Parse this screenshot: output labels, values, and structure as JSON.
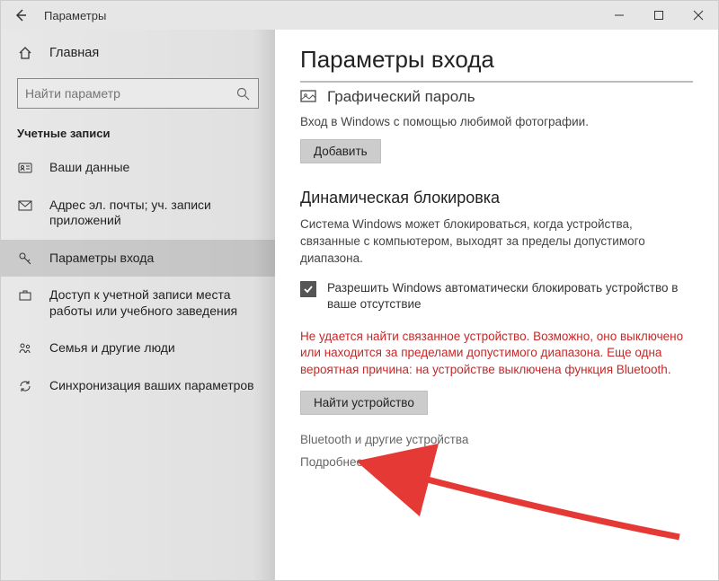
{
  "titlebar": {
    "title": "Параметры"
  },
  "sidebar": {
    "home_label": "Главная",
    "search_placeholder": "Найти параметр",
    "section_title": "Учетные записи",
    "items": [
      {
        "label": "Ваши данные"
      },
      {
        "label": "Адрес эл. почты; уч. записи приложений"
      },
      {
        "label": "Параметры входа"
      },
      {
        "label": "Доступ к учетной записи места работы или учебного заведения"
      },
      {
        "label": "Семья и другие люди"
      },
      {
        "label": "Синхронизация ваших параметров"
      }
    ]
  },
  "content": {
    "page_title": "Параметры входа",
    "picture_password_heading": "Графический пароль",
    "picture_password_desc": "Вход в Windows с помощью любимой фотографии.",
    "add_button": "Добавить",
    "dynlock_heading": "Динамическая блокировка",
    "dynlock_desc": "Система Windows может блокироваться, когда устройства, связанные с компьютером, выходят за пределы допустимого диапазона.",
    "dynlock_checkbox": "Разрешить Windows автоматически блокировать устройство в ваше отсутствие",
    "dynlock_error": "Не удается найти связанное устройство. Возможно, оно выключено или находится за пределами допустимого диапазона. Еще одна вероятная причина: на устройстве выключена функция Bluetooth.",
    "find_device_button": "Найти устройство",
    "link1": "Bluetooth и другие устройства",
    "link2": "Подробнее"
  }
}
